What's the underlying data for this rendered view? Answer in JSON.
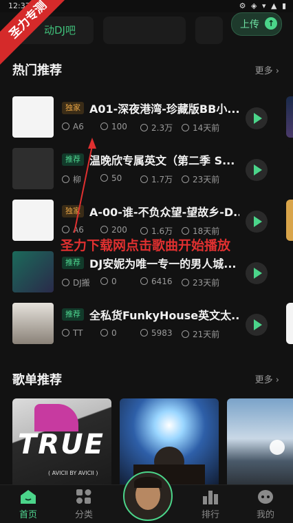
{
  "status_bar": {
    "time": "12:37",
    "icons": "⚙ ◈ ▾ ▲ ▮"
  },
  "corner_badge": "圣力专测",
  "top": {
    "chip1_label": "动DJ吧",
    "upload_label": "上传",
    "upload_icon": "upload-icon"
  },
  "hot": {
    "title": "热门推荐",
    "more": "更多 ›",
    "songs": [
      {
        "tag": "独家",
        "tag_type": "exclusive",
        "title": "A01-深夜港湾-珍藏版BB小...",
        "author": "A6",
        "coins": "100",
        "plays": "2.3万",
        "time": "14天前"
      },
      {
        "tag": "推荐",
        "tag_type": "recommend",
        "title": "温晚欣专属英文（第二季 S...",
        "author": "柳",
        "coins": "50",
        "plays": "1.7万",
        "time": "23天前"
      },
      {
        "tag": "独家",
        "tag_type": "exclusive",
        "title": "A-00-谁-不负众望-望故乡-D...",
        "author": "A6",
        "coins": "200",
        "plays": "1.6万",
        "time": "18天前"
      },
      {
        "tag": "推荐",
        "tag_type": "recommend",
        "title": "DJ安妮为唯一专一的男人城...",
        "author": "DJ搬",
        "coins": "0",
        "plays": "6416",
        "time": "23天前"
      },
      {
        "tag": "推荐",
        "tag_type": "recommend",
        "title": "全私货FunkyHouse英文太...",
        "author": "TT",
        "coins": "0",
        "plays": "5983",
        "time": "21天前"
      }
    ]
  },
  "annotation": "圣力下载网点击歌曲开始播放",
  "playlists": {
    "title": "歌单推荐",
    "more": "更多 ›",
    "cover1_text": "TRUE",
    "cover1_sub": "( AVICII BY AVICII )"
  },
  "tabs": [
    {
      "label": "首页",
      "icon": "home-icon"
    },
    {
      "label": "分类",
      "icon": "category-icon"
    },
    {
      "label": "排行",
      "icon": "ranking-icon"
    },
    {
      "label": "我的",
      "icon": "profile-icon"
    }
  ],
  "colors": {
    "accent": "#4bd58a",
    "background": "#121212",
    "exclusive_tag": "#e9a545"
  }
}
